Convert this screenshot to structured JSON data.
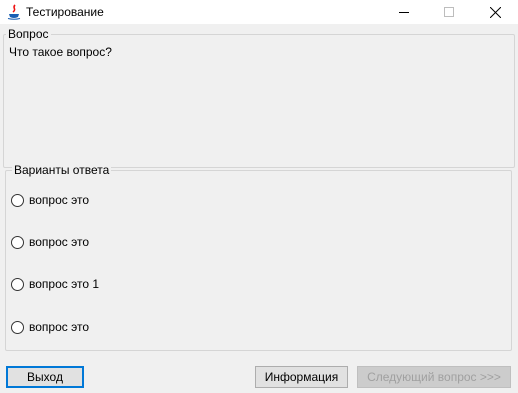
{
  "window": {
    "title": "Тестирование",
    "icon": "java-cup-icon"
  },
  "question": {
    "legend": "Вопрос",
    "text": "Что такое вопрос?"
  },
  "answers": {
    "legend": "Варианты ответа",
    "options": [
      {
        "label": "вопрос это",
        "selected": false
      },
      {
        "label": "вопрос это",
        "selected": false
      },
      {
        "label": "вопрос это 1",
        "selected": false
      },
      {
        "label": "вопрос это",
        "selected": false
      }
    ]
  },
  "buttons": {
    "exit": "Выход",
    "info": "Информация",
    "next": "Следующий вопрос >>>",
    "next_enabled": false
  },
  "colors": {
    "focus_border": "#0078d7",
    "window_bg": "#f0f0f0"
  }
}
